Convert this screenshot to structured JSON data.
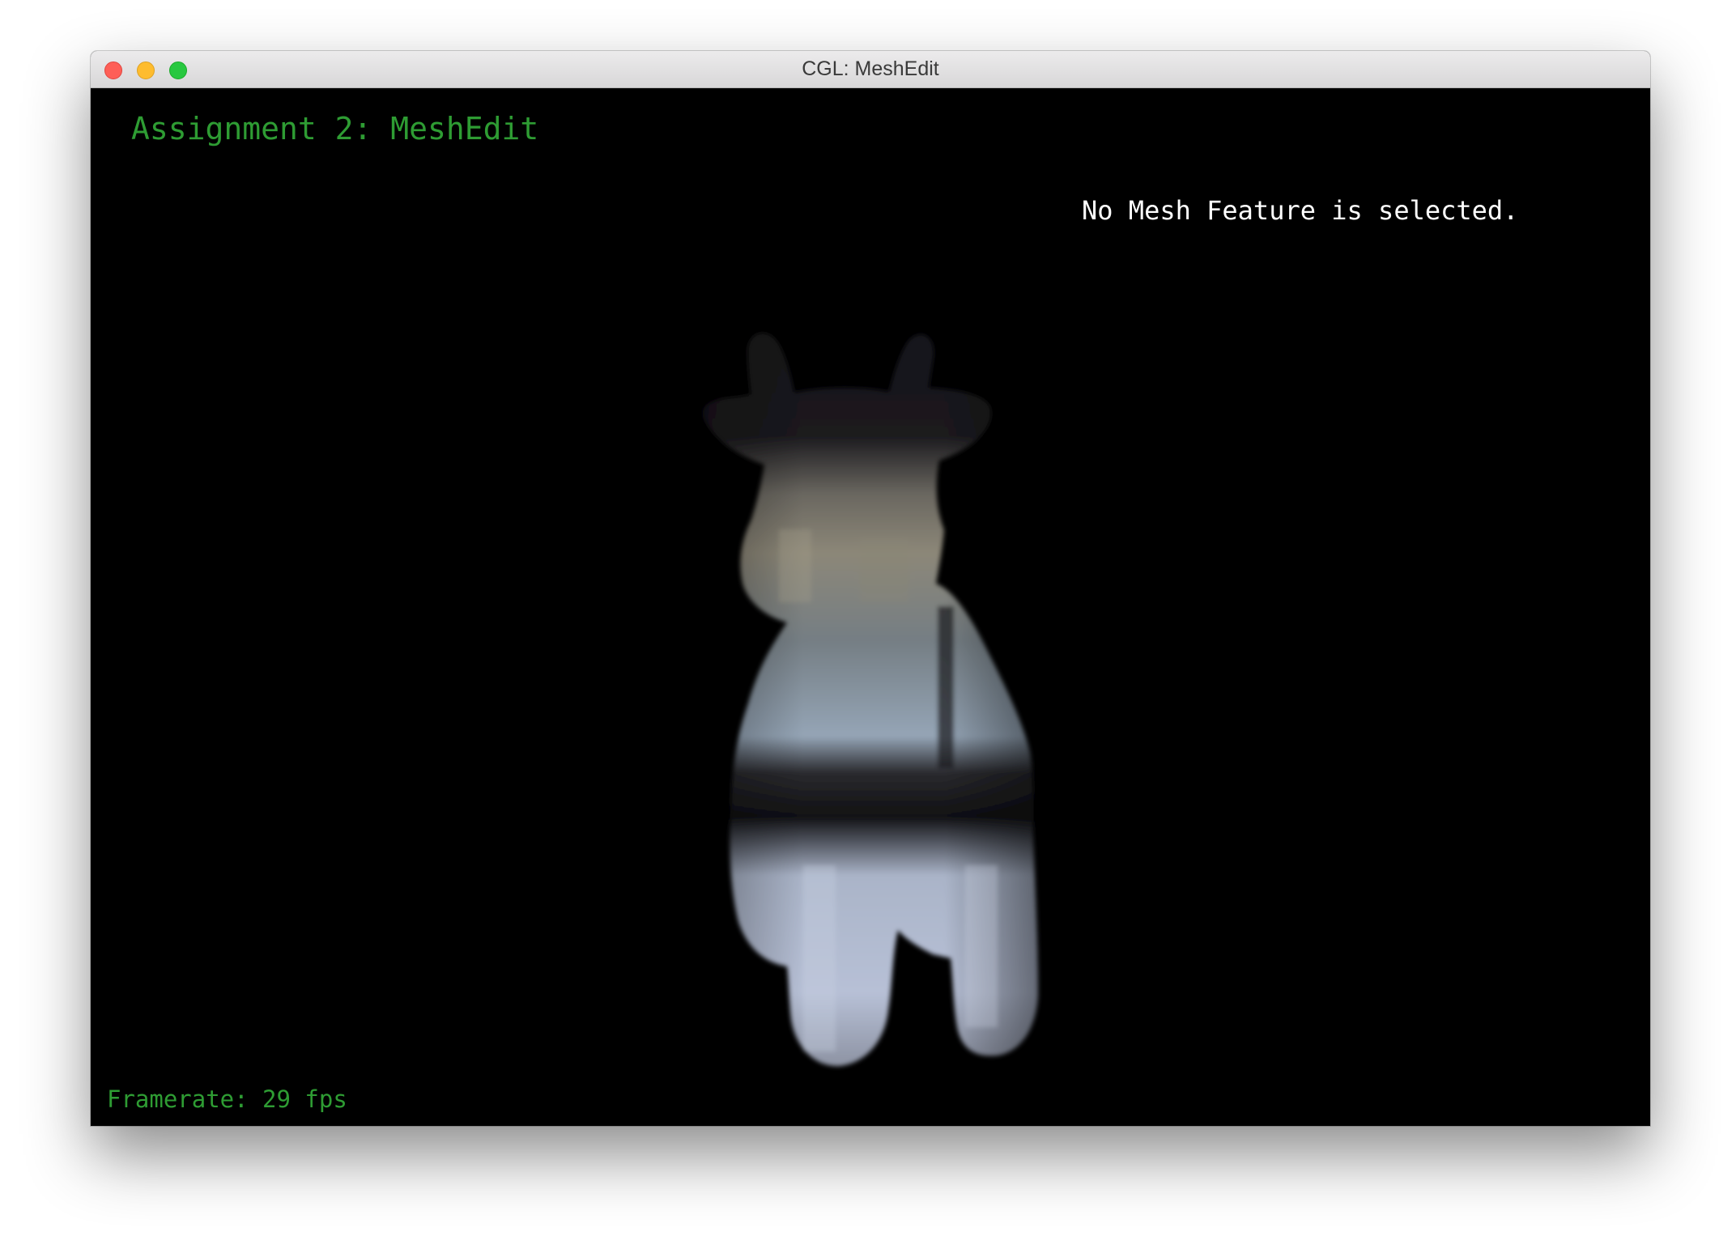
{
  "window": {
    "title": "CGL: MeshEdit"
  },
  "viewport": {
    "heading": "Assignment 2: MeshEdit",
    "selection_status": "No Mesh Feature is selected.",
    "framerate": "Framerate: 29 fps"
  },
  "colors": {
    "heading_green": "#2e9c33",
    "viewport_background": "#000000",
    "status_text": "#ffffff"
  },
  "icons": {
    "close": "close-icon",
    "minimize": "minimize-icon",
    "maximize": "maximize-icon"
  }
}
